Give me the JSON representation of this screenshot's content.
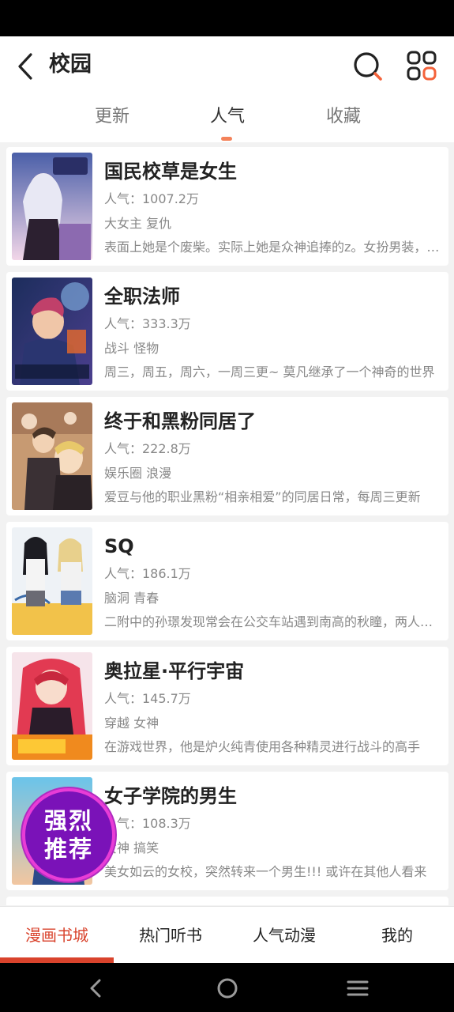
{
  "header": {
    "title": "校园"
  },
  "tabs": [
    {
      "label": "更新"
    },
    {
      "label": "人气"
    },
    {
      "label": "收藏"
    }
  ],
  "comics": [
    {
      "title": "国民校草是女生",
      "popularity": "人气：1007.2万",
      "tags": "大女主 复仇",
      "desc": "表面上她是个废柴。实际上她是众神追捧的z。女扮男装，欢迎收看"
    },
    {
      "title": "全职法师",
      "popularity": "人气：333.3万",
      "tags": "战斗 怪物",
      "desc": "周三，周五，周六，一周三更~ 莫凡继承了一个神奇的世界"
    },
    {
      "title": "终于和黑粉同居了",
      "popularity": "人气：222.8万",
      "tags": "娱乐圈 浪漫",
      "desc": "爱豆与他的职业黑粉“相亲相爱”的同居日常，每周三更新"
    },
    {
      "title": "SQ",
      "popularity": "人气：186.1万",
      "tags": "脑洞 青春",
      "desc": "二附中的孙璟发现常会在公交车站遇到南高的秋瞳，两人之间"
    },
    {
      "title": "奥拉星·平行宇宙",
      "popularity": "人气：145.7万",
      "tags": "穿越 女神",
      "desc": "在游戏世界，他是炉火纯青使用各种精灵进行战斗的高手"
    },
    {
      "title": "女子学院的男生",
      "popularity": "人气：108.3万",
      "tags": "女神 搞笑",
      "desc": "美女如云的女校，突然转来一个男生!!! 或许在其他人看来"
    }
  ],
  "badge": {
    "line1": "强烈",
    "line2": "推荐"
  },
  "bottom_nav": [
    {
      "label": "漫画书城"
    },
    {
      "label": "热门听书"
    },
    {
      "label": "人气动漫"
    },
    {
      "label": "我的"
    }
  ],
  "colors": {
    "accent": "#d9432c",
    "tab_indicator": "#f4825a",
    "badge": "#7a12b8"
  },
  "icons": [
    "back-icon",
    "search-icon",
    "grid-icon",
    "nav-back-icon",
    "nav-home-icon",
    "nav-recents-icon"
  ]
}
